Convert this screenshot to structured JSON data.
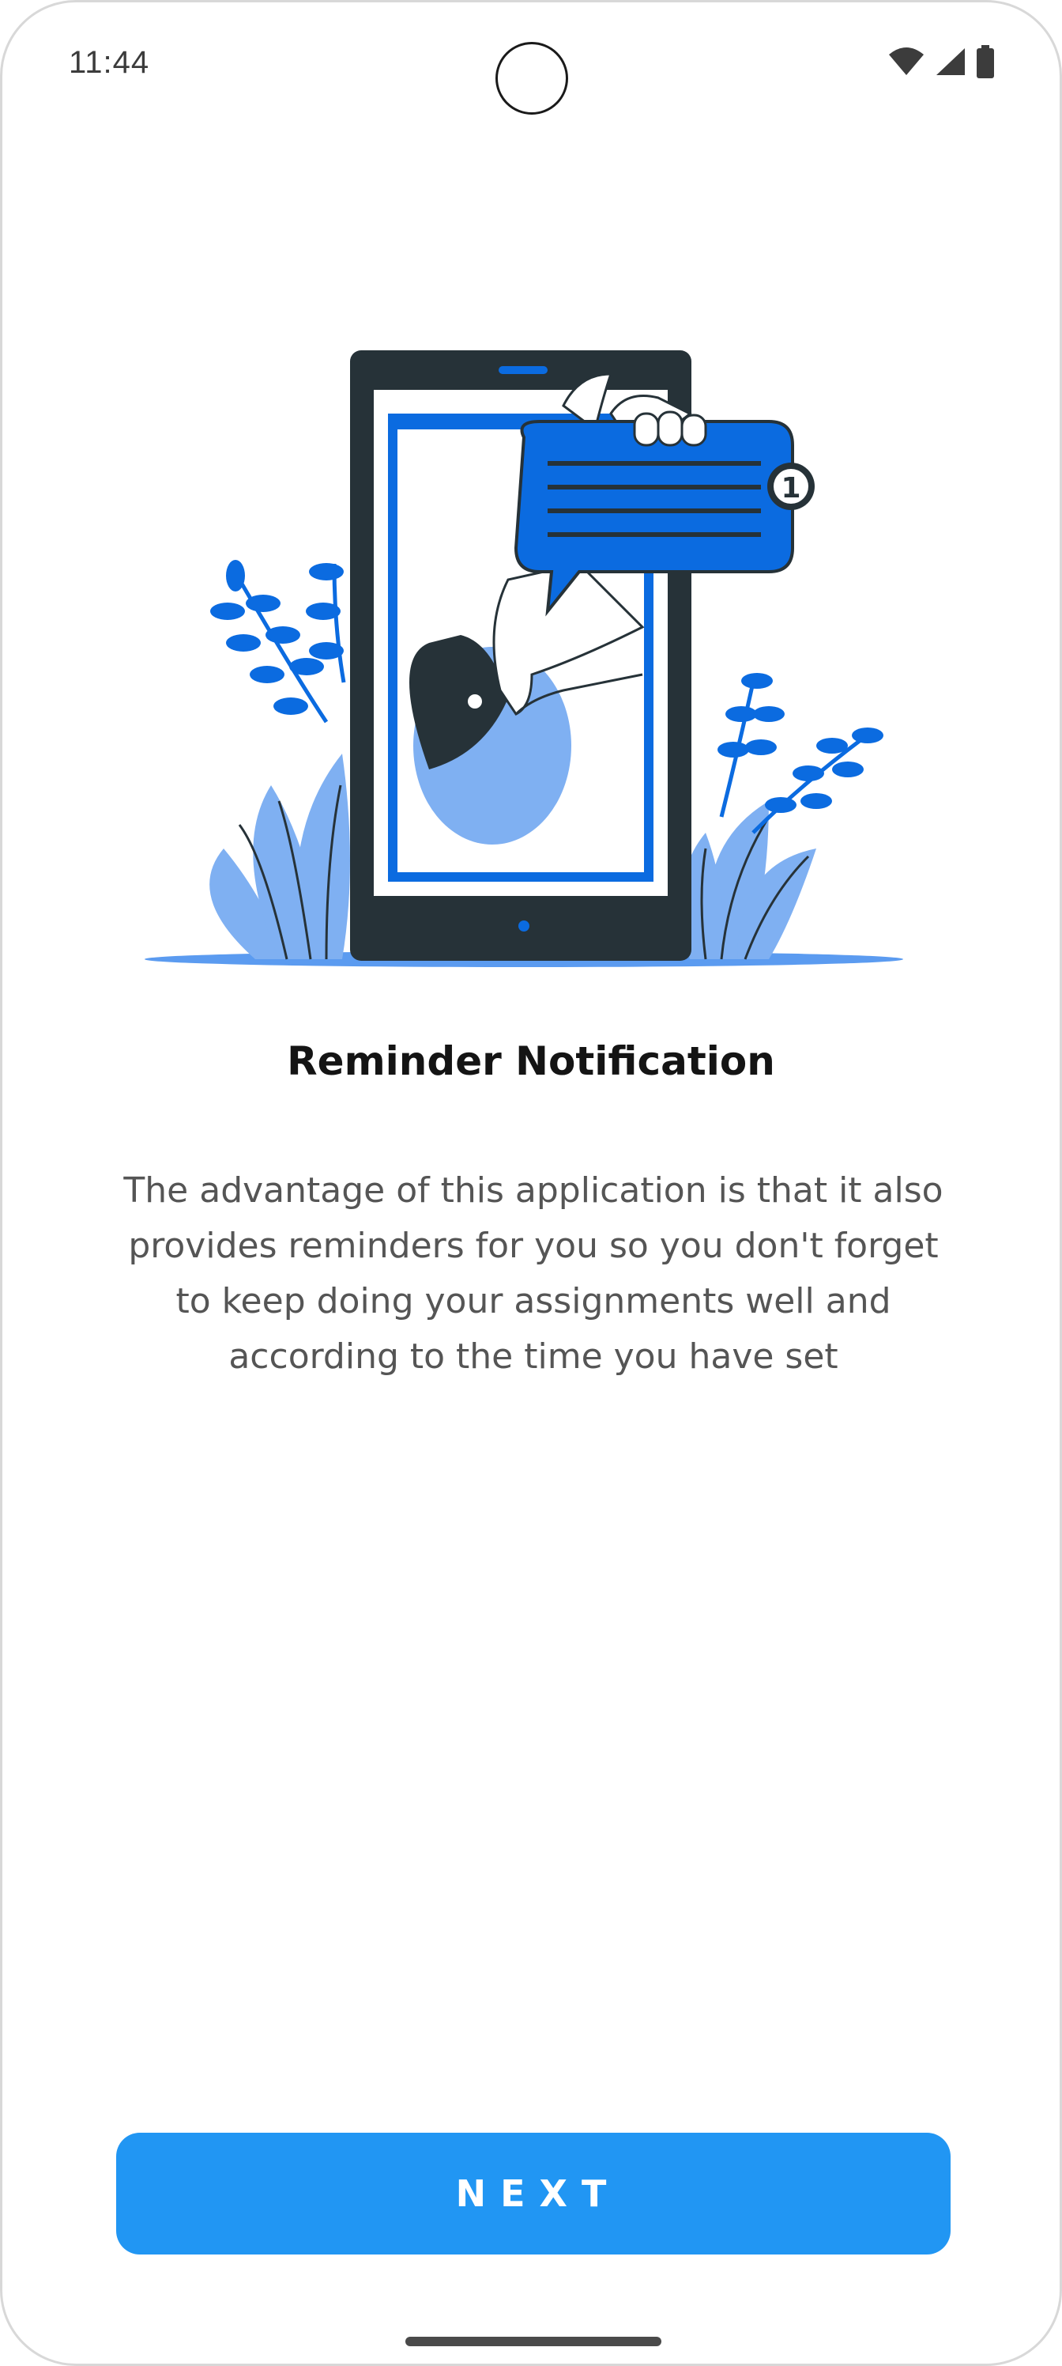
{
  "status_bar": {
    "time": "11:44",
    "icons": [
      "wifi-icon",
      "cell-signal-icon",
      "battery-icon"
    ]
  },
  "illustration": {
    "icon": "phone-notification-illustration",
    "badge_count": "1",
    "colors": {
      "primary_blue": "#0b6be0",
      "light_blue": "#7fb0f2",
      "dark": "#263238"
    }
  },
  "onboarding": {
    "title": "Reminder Notification",
    "description": "The advantage of this application is that it also provides reminders for you so you don't forget to keep doing your assignments well and according to the time you have set"
  },
  "actions": {
    "next_label": "NEXT",
    "accent_color": "#2196f3"
  }
}
